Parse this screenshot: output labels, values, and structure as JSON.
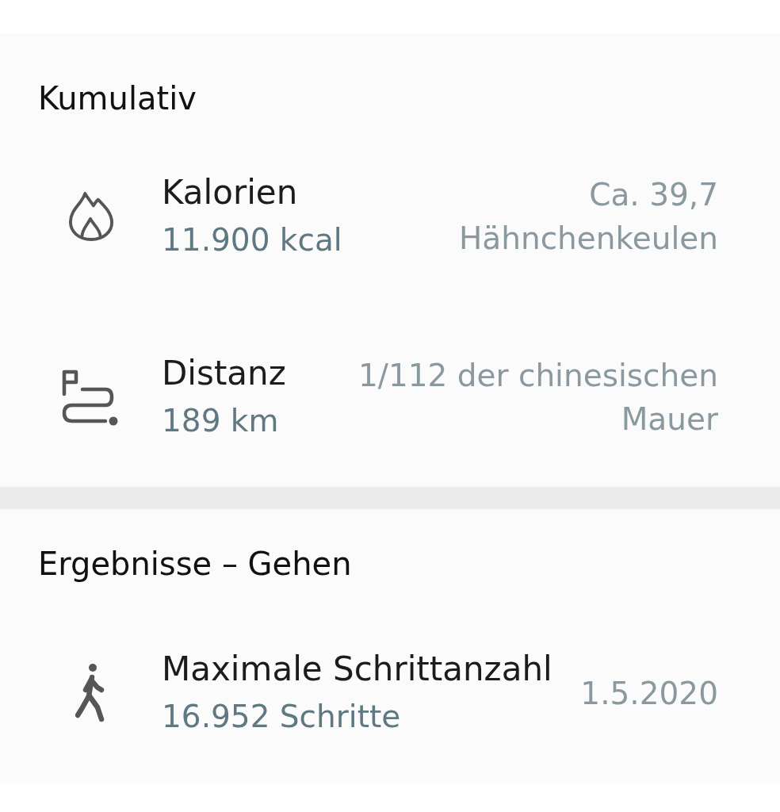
{
  "sections": [
    {
      "title": "Kumulativ",
      "rows": [
        {
          "kind": "calories",
          "title": "Kalorien",
          "value": "11.900 kcal",
          "comparison": "Ca. 39,7 Hähnchenkeulen"
        },
        {
          "kind": "distance",
          "title": "Distanz",
          "value": "189 km",
          "comparison": "1/112 der chinesischen Mauer"
        }
      ]
    },
    {
      "title": "Ergebnisse – Gehen",
      "rows": [
        {
          "kind": "steps",
          "title": "Maximale Schrittanzahl",
          "value": "16.952 Schritte",
          "date": "1.5.2020"
        }
      ]
    }
  ]
}
